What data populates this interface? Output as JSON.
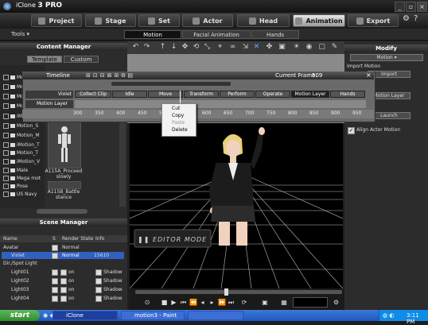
{
  "app": {
    "title_prefix": "iClone",
    "title_version": "3 PRO"
  },
  "main_tabs": [
    {
      "label": "Project",
      "active": false
    },
    {
      "label": "Stage",
      "active": false
    },
    {
      "label": "Set",
      "active": false
    },
    {
      "label": "Actor",
      "active": false
    },
    {
      "label": "Head",
      "active": false
    },
    {
      "label": "Animation",
      "active": true
    },
    {
      "label": "Export",
      "active": false
    }
  ],
  "tools_label": "Tools",
  "sub_tabs": [
    {
      "label": "Motion",
      "active": true
    },
    {
      "label": "Facial Animation",
      "active": false
    },
    {
      "label": "Hands",
      "active": false
    }
  ],
  "content_manager": {
    "title": "Content Manager",
    "tabs": [
      "Template",
      "Custom"
    ],
    "tree_items": [
      "Motio",
      "Motion_A",
      "Motion_B",
      "Motion_C",
      "iMotion_D",
      "Motion_S",
      "Motion_M",
      "iMotion_T",
      "Motion_T",
      "iMotion_V",
      "Male",
      "Mega mot",
      "Pose",
      "US Navy"
    ],
    "thumbs": [
      "A115A_Proceed slowly",
      "A115B_Battle stance"
    ]
  },
  "scene_manager": {
    "title": "Scene Manager",
    "columns": [
      "Name",
      "S",
      "Render State",
      "Info"
    ],
    "rows": [
      {
        "name": "Avatar",
        "render": "Normal",
        "info": "",
        "type": "group"
      },
      {
        "name": "Violet",
        "render": "Normal",
        "info": "15610",
        "type": "selected"
      },
      {
        "name": "Dir./Spot Light",
        "render": "",
        "info": "",
        "type": "group"
      },
      {
        "name": "Light01",
        "render": "on",
        "info": "Shadow",
        "type": "light"
      },
      {
        "name": "Light02",
        "render": "on",
        "info": "Shadow",
        "type": "light"
      },
      {
        "name": "Light03",
        "render": "on",
        "info": "Shadow",
        "type": "light"
      },
      {
        "name": "Light04",
        "render": "on",
        "info": "Shadow",
        "type": "light"
      }
    ]
  },
  "timeline": {
    "title": "Timeline",
    "current_frame_label": "Current Frame:",
    "current_frame": "509",
    "actor_label": "Violet",
    "layer_label": "Motion Layer",
    "track_cells": [
      {
        "label": "Collect Clip",
        "active": false
      },
      {
        "label": "Idle",
        "active": false
      },
      {
        "label": "Move",
        "active": false
      },
      {
        "label": "Transform",
        "active": false
      },
      {
        "label": "Perform",
        "active": false
      },
      {
        "label": "Operate",
        "active": false
      },
      {
        "label": "Motion Layer",
        "active": true
      },
      {
        "label": "Hands",
        "active": false
      }
    ],
    "ticks": [
      "300",
      "350",
      "400",
      "450",
      "500",
      "550",
      "600",
      "650",
      "700",
      "750",
      "800",
      "850",
      "900",
      "950"
    ]
  },
  "context_menu": {
    "items": [
      {
        "label": "Cut",
        "enabled": true
      },
      {
        "label": "Copy",
        "enabled": true
      },
      {
        "label": "Paste",
        "enabled": false
      },
      {
        "label": "Delete",
        "enabled": true
      }
    ]
  },
  "viewport": {
    "mode_label": "EDITOR MODE"
  },
  "modify": {
    "title": "Modify",
    "dropdown": "Motion",
    "import_motion_label": "Import Motion",
    "import_button": "Import",
    "motion_layer_button": "Motion Layer",
    "launch_button": "Launch",
    "align_checkbox": "Align Actor Motion",
    "align_checked": true
  },
  "taskbar": {
    "start_label": "start",
    "tasks": [
      {
        "label": "iClone",
        "active": true
      },
      {
        "label": "motion3 - Paint",
        "active": false
      },
      {
        "label": "",
        "active": false
      }
    ],
    "clock": "3:11 PM"
  }
}
